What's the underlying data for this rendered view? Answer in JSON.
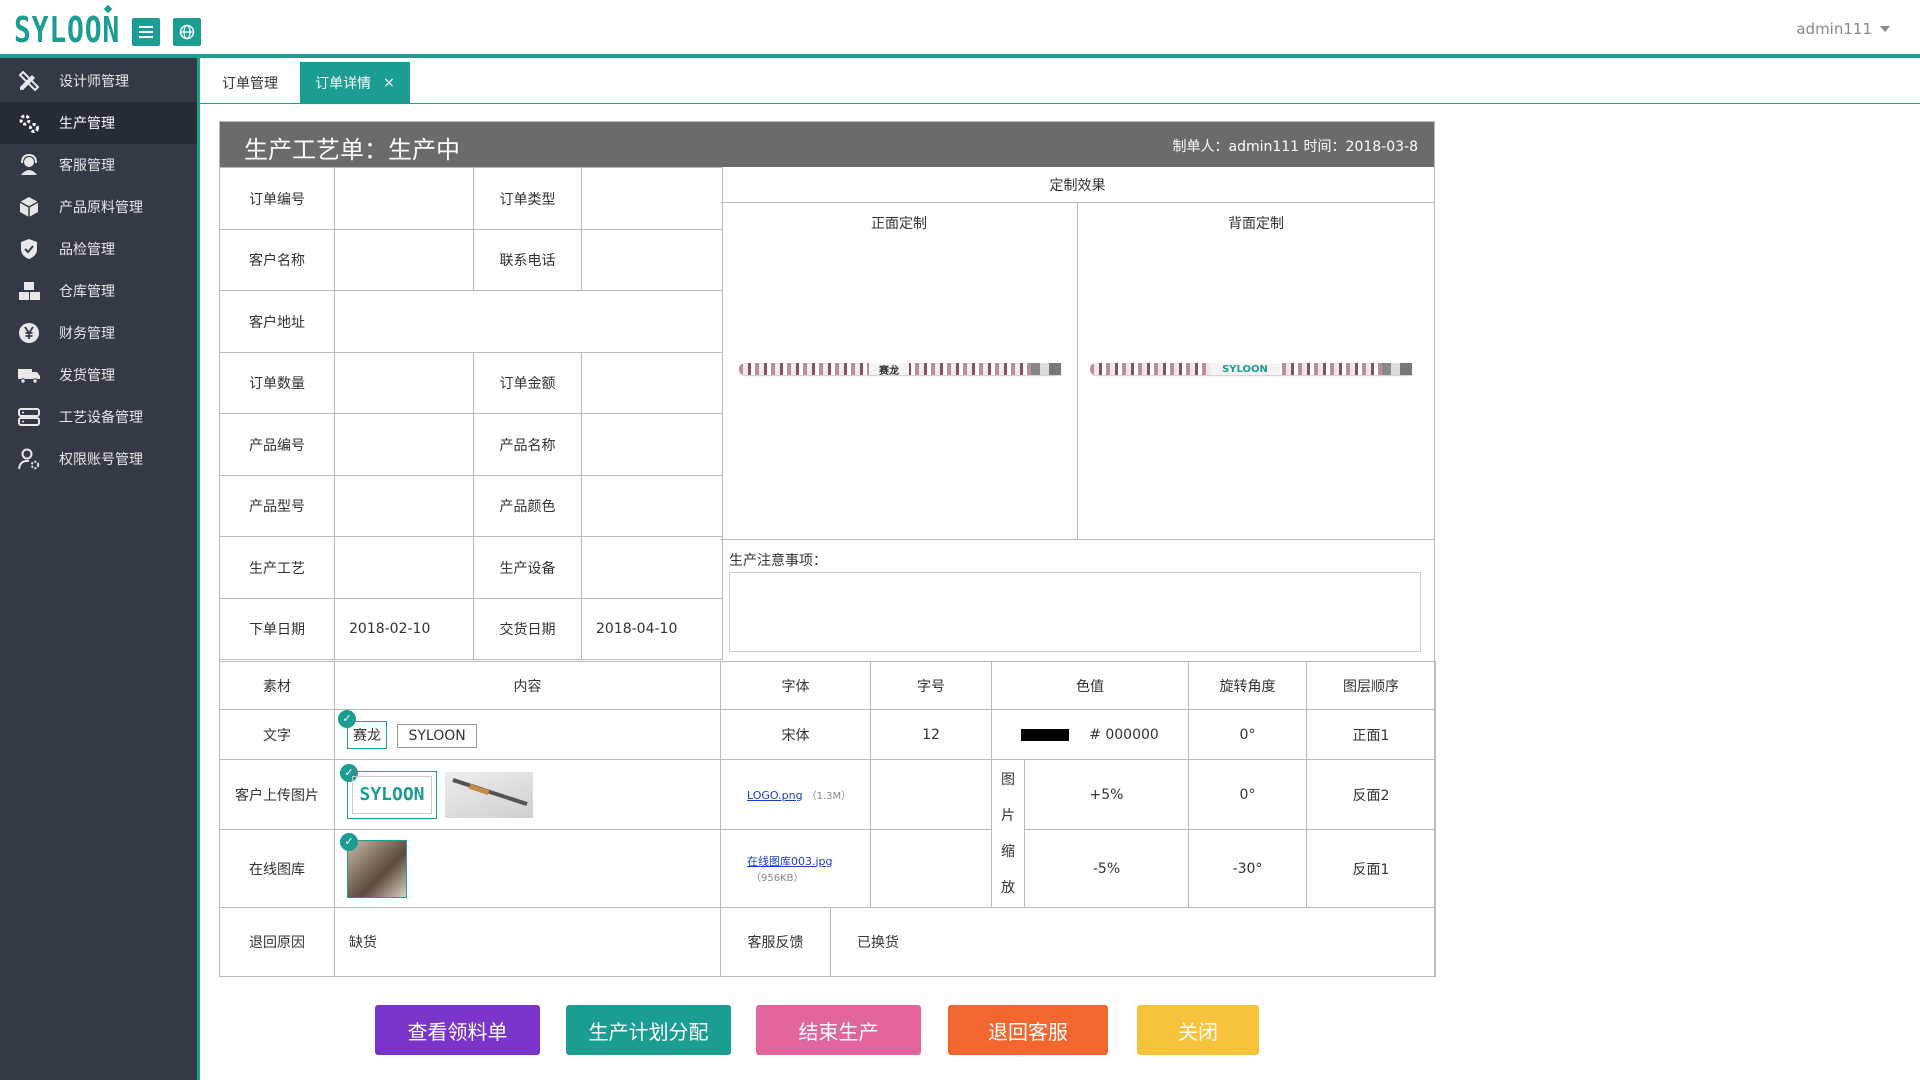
{
  "app": {
    "logo_text": "SYLOON",
    "user": "admin111"
  },
  "sidebar": {
    "items": [
      {
        "label": "设计师管理",
        "icon": "pencil-ruler-icon"
      },
      {
        "label": "生产管理",
        "icon": "gears-icon"
      },
      {
        "label": "客服管理",
        "icon": "headset-icon"
      },
      {
        "label": "产品原料管理",
        "icon": "box-icon"
      },
      {
        "label": "品检管理",
        "icon": "shield-check-icon"
      },
      {
        "label": "仓库管理",
        "icon": "boxes-icon"
      },
      {
        "label": "财务管理",
        "icon": "yen-icon"
      },
      {
        "label": "发货管理",
        "icon": "truck-icon"
      },
      {
        "label": "工艺设备管理",
        "icon": "server-icon"
      },
      {
        "label": "权限账号管理",
        "icon": "user-gear-icon"
      }
    ],
    "active_index": 1
  },
  "tabs": [
    {
      "label": "订单管理"
    },
    {
      "label": "订单详情",
      "close": "×"
    }
  ],
  "sheet": {
    "title": "生产工艺单：生产中",
    "meta": "制单人：admin111   时间：2018-03-8"
  },
  "info": {
    "order_no": "订单编号",
    "order_type": "订单类型",
    "customer_name": "客户名称",
    "phone": "联系电话",
    "address": "客户地址",
    "quantity": "订单数量",
    "amount": "订单金额",
    "product_no": "产品编号",
    "product_name": "产品名称",
    "product_model": "产品型号",
    "product_color": "产品颜色",
    "process": "生产工艺",
    "equipment": "生产设备",
    "order_date_label": "下单日期",
    "order_date": "2018-02-10",
    "delivery_date_label": "交货日期",
    "delivery_date": "2018-04-10"
  },
  "effect": {
    "title": "定制效果",
    "front": "正面定制",
    "back": "背面定制",
    "front_text": "赛龙",
    "back_text": "SYLOON"
  },
  "notes": {
    "label": "生产注意事项："
  },
  "materials": {
    "headers": [
      "素材",
      "内容",
      "字体",
      "字号",
      "色值",
      "旋转角度",
      "图层顺序"
    ],
    "text_row": {
      "label": "文字",
      "tag1": "赛龙",
      "tag2": "SYLOON",
      "font": "宋体",
      "size": "12",
      "color": "# 000000",
      "rotation": "0°",
      "layer": "正面1"
    },
    "upload_row": {
      "label": "客户上传图片",
      "logo_text": "SYLOON",
      "file": "LOGO.png",
      "file_size": "（1.3M）",
      "scale_label": [
        "图",
        "片",
        "缩",
        "放"
      ],
      "scale": "+5%",
      "rotation": "0°",
      "layer": "反面2"
    },
    "gallery_row": {
      "label": "在线图库",
      "file": "在线图库003.jpg",
      "file_size": "（956KB）",
      "scale": "-5%",
      "rotation": "-30°",
      "layer": "反面1"
    },
    "return_row": {
      "label": "退回原因",
      "reason": "缺货",
      "feedback_label": "客服反馈",
      "feedback": "已换货"
    }
  },
  "buttons": [
    {
      "label": "查看领料单",
      "color": "#7a34c9"
    },
    {
      "label": "生产计划分配",
      "color": "#1c9d92"
    },
    {
      "label": "结束生产",
      "color": "#e2649c"
    },
    {
      "label": "退回客服",
      "color": "#f4662f"
    },
    {
      "label": "关闭",
      "color": "#f7c23c"
    }
  ],
  "colors": {
    "accent": "#1c9d92",
    "sidebar": "#333a45"
  }
}
